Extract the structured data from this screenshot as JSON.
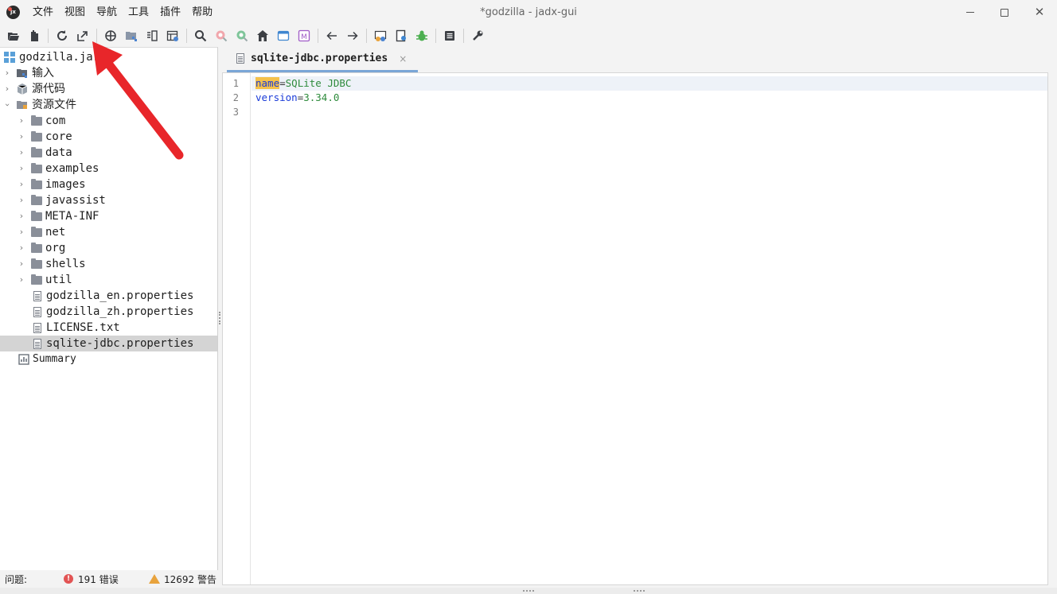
{
  "window": {
    "title": "*godzilla - jadx-gui",
    "logo_text": "jx"
  },
  "menu": [
    "文件",
    "视图",
    "导航",
    "工具",
    "插件",
    "帮助"
  ],
  "toolbar": {
    "buttons": [
      "open-file-icon",
      "add-file-icon",
      "reload-icon",
      "export-icon",
      "sync-icon",
      "flatten-packages-icon",
      "split-view-icon",
      "table-icon",
      "search-icon",
      "find-usage-icon",
      "find-class-icon",
      "home-icon",
      "smali-icon",
      "mapping-icon",
      "back-icon",
      "forward-icon",
      "log-icon",
      "quark-icon",
      "debug-icon",
      "log-viewer-icon",
      "preferences-icon"
    ]
  },
  "tree": {
    "root": "godzilla.jar",
    "nodes": [
      {
        "label": "输入",
        "level": 1,
        "type": "inputs"
      },
      {
        "label": "源代码",
        "level": 1,
        "type": "sources"
      },
      {
        "label": "资源文件",
        "level": 1,
        "type": "resources",
        "expanded": true
      },
      {
        "label": "com",
        "level": 2,
        "type": "folder"
      },
      {
        "label": "core",
        "level": 2,
        "type": "folder"
      },
      {
        "label": "data",
        "level": 2,
        "type": "folder"
      },
      {
        "label": "examples",
        "level": 2,
        "type": "folder"
      },
      {
        "label": "images",
        "level": 2,
        "type": "folder"
      },
      {
        "label": "javassist",
        "level": 2,
        "type": "folder"
      },
      {
        "label": "META-INF",
        "level": 2,
        "type": "folder"
      },
      {
        "label": "net",
        "level": 2,
        "type": "folder"
      },
      {
        "label": "org",
        "level": 2,
        "type": "folder"
      },
      {
        "label": "shells",
        "level": 2,
        "type": "folder"
      },
      {
        "label": "util",
        "level": 2,
        "type": "folder"
      },
      {
        "label": "godzilla_en.properties",
        "level": 2,
        "type": "file"
      },
      {
        "label": "godzilla_zh.properties",
        "level": 2,
        "type": "file"
      },
      {
        "label": "LICENSE.txt",
        "level": 2,
        "type": "file"
      },
      {
        "label": "sqlite-jdbc.properties",
        "level": 2,
        "type": "file",
        "selected": true
      },
      {
        "label": "Summary",
        "level": 1,
        "type": "summary"
      }
    ]
  },
  "editor": {
    "tab_label": "sqlite-jdbc.properties",
    "tab_close": "×",
    "line_numbers": [
      "1",
      "2",
      "3"
    ],
    "lines": [
      {
        "key": "name",
        "eq": "=",
        "value": "SQLite JDBC"
      },
      {
        "key": "version",
        "eq": "=",
        "value": "3.34.0"
      }
    ]
  },
  "status": {
    "label": "问题:",
    "error_icon": "!",
    "errors": "191 错误",
    "warnings": "12692 警告"
  },
  "colors": {
    "annotation_arrow": "#e8262a",
    "key": "#1a3bd8",
    "value": "#2e8b3c",
    "highlight": "#f5c14a"
  }
}
